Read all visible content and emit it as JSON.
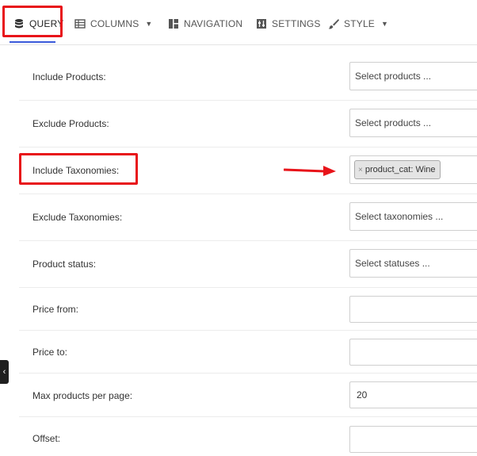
{
  "tabs": [
    {
      "label": "QUERY",
      "icon": "database-icon",
      "active": true
    },
    {
      "label": "COLUMNS",
      "icon": "table-icon",
      "has_dropdown": true
    },
    {
      "label": "NAVIGATION",
      "icon": "layout-icon"
    },
    {
      "label": "SETTINGS",
      "icon": "sliders-icon"
    },
    {
      "label": "STYLE",
      "icon": "brush-icon",
      "has_dropdown": true
    }
  ],
  "fields": [
    {
      "label": "Include Products:",
      "placeholder": "Select products ..."
    },
    {
      "label": "Exclude Products:",
      "placeholder": "Select products ..."
    },
    {
      "label": "Include Taxonomies:",
      "chip": "product_cat: Wine",
      "chip_remove": "×"
    },
    {
      "label": "Exclude Taxonomies:",
      "placeholder": "Select taxonomies ..."
    },
    {
      "label": "Product status:",
      "placeholder": "Select statuses ..."
    },
    {
      "label": "Price from:",
      "value": ""
    },
    {
      "label": "Price to:",
      "value": ""
    },
    {
      "label": "Max products per page:",
      "value": "20"
    },
    {
      "label": "Offset:",
      "value": ""
    }
  ],
  "colors": {
    "highlight": "#e8141a",
    "active_tab_underline": "#3b5bdb"
  },
  "sidebar_toggle": {
    "icon": "chevron-left-icon",
    "glyph": "‹"
  }
}
